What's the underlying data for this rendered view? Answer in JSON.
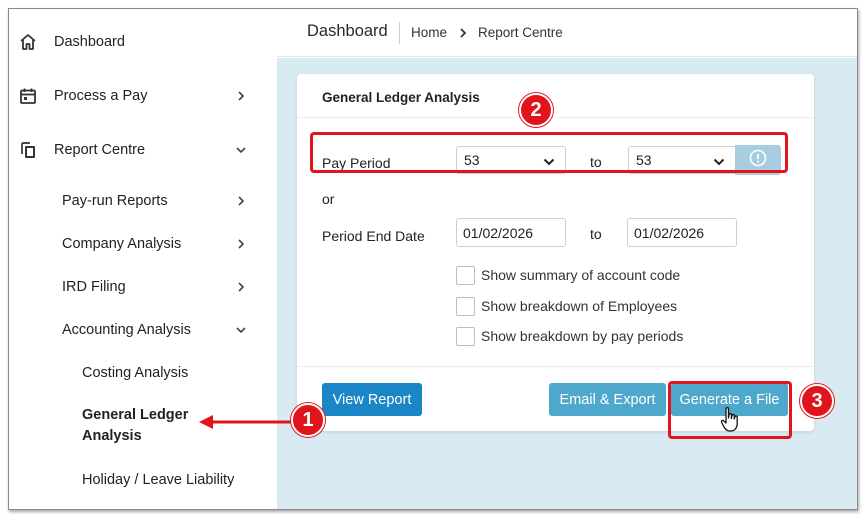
{
  "sidebar": {
    "items": [
      {
        "label": "Dashboard",
        "icon": "home-icon"
      },
      {
        "label": "Process a Pay",
        "icon": "calendar-icon"
      },
      {
        "label": "Report Centre",
        "icon": "copy-documents-icon"
      },
      {
        "label": "Pay-run Reports"
      },
      {
        "label": "Company Analysis"
      },
      {
        "label": "IRD Filing"
      },
      {
        "label": "Accounting Analysis"
      },
      {
        "label": "Costing Analysis"
      },
      {
        "label": "General Ledger",
        "label2": "Analysis"
      },
      {
        "label": "Holiday / Leave Liability"
      }
    ]
  },
  "header": {
    "title": "Dashboard",
    "breadcrumb": {
      "home": "Home",
      "current": "Report Centre"
    }
  },
  "form": {
    "title": "General Ledger Analysis",
    "pay_period_label": "Pay Period",
    "pay_period_from": "53",
    "to_label": "to",
    "pay_period_to": "53",
    "or_label": "or",
    "period_end_label": "Period End Date",
    "period_end_from": "01/02/2026",
    "period_end_to": "01/02/2026",
    "checkboxes": [
      "Show summary of account code",
      "Show breakdown of Employees",
      "Show breakdown by pay periods"
    ],
    "buttons": {
      "view_report": "View Report",
      "email_export": "Email & Export",
      "generate_file": "Generate a File"
    }
  },
  "annotations": {
    "badge1": "1",
    "badge2": "2",
    "badge3": "3"
  },
  "colors": {
    "accent": "#1a86c5",
    "highlight": "#e0141b",
    "main_bg": "#d9ebf2"
  }
}
